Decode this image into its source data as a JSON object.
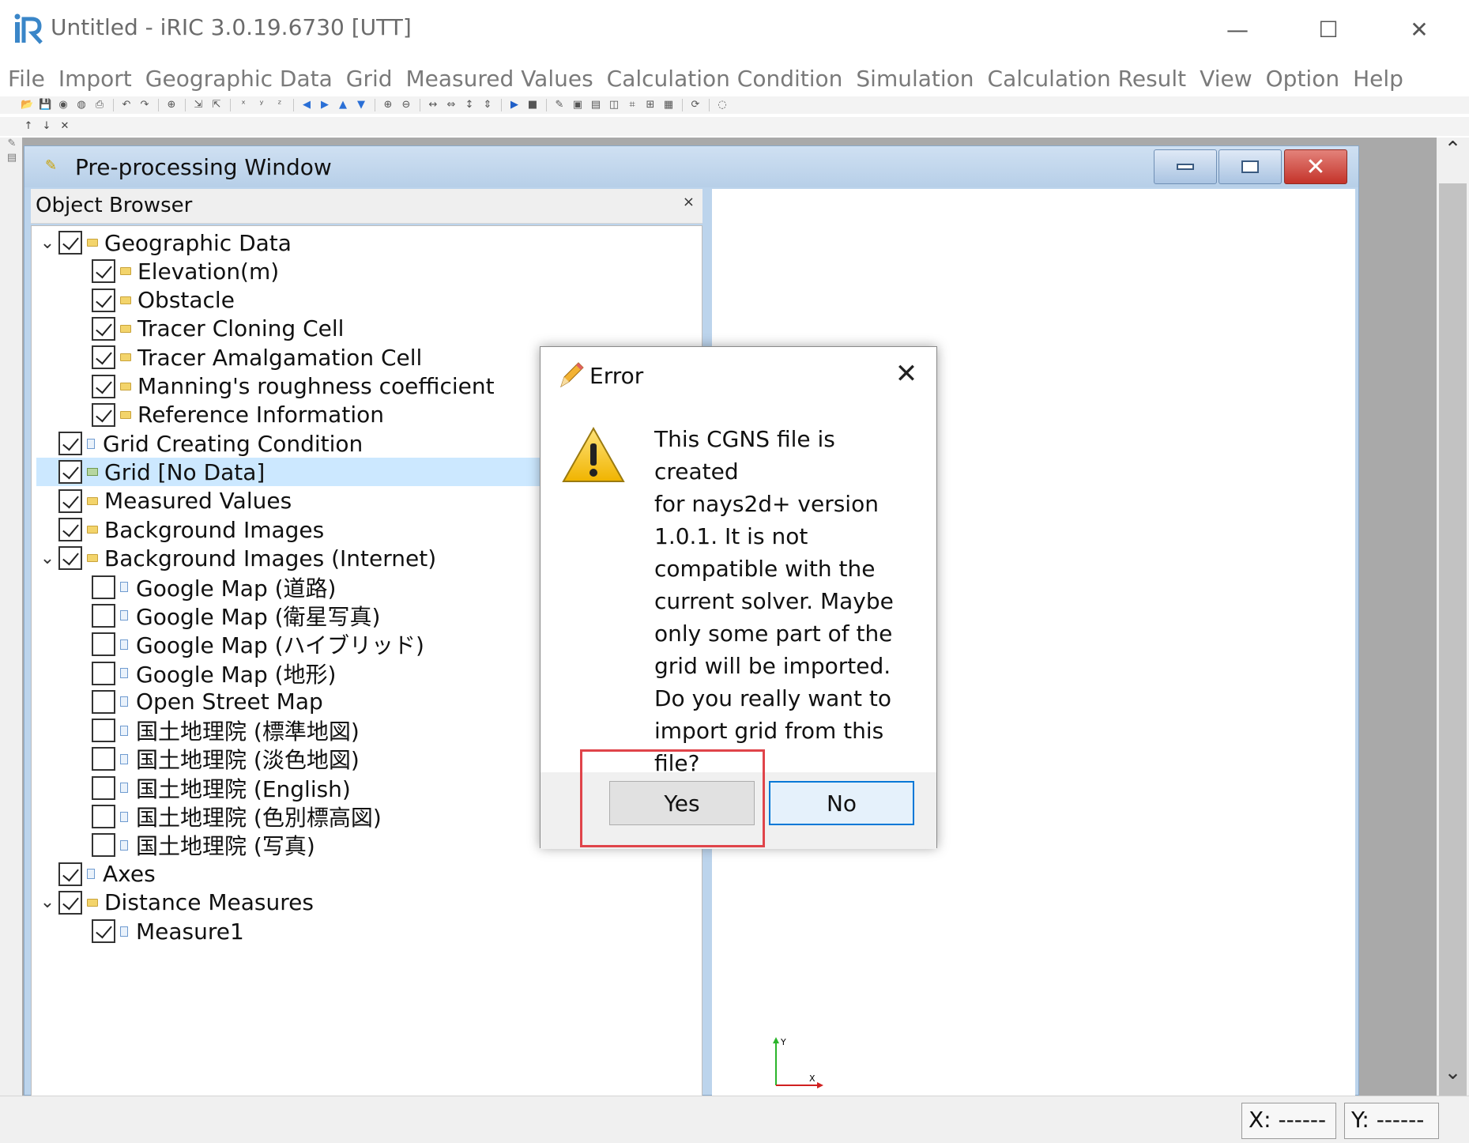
{
  "window": {
    "title": "Untitled - iRIC 3.0.19.6730 [UTT]",
    "controls": {
      "minimize": "—",
      "maximize": "☐",
      "close": "✕"
    }
  },
  "menu": [
    "File",
    "Import",
    "Geographic Data",
    "Grid",
    "Measured Values",
    "Calculation Condition",
    "Simulation",
    "Calculation Result",
    "View",
    "Option",
    "Help"
  ],
  "toolbar_icons": [
    "open-icon",
    "save-icon",
    "snapshot-icon",
    "snapshot-movie-icon",
    "print-icon",
    "undo-icon",
    "redo-icon",
    "zoom-fit-icon",
    "import-icon",
    "export-icon",
    "x-axis-icon",
    "y-axis-icon",
    "z-axis-icon",
    "move-left-icon",
    "move-right-icon",
    "move-up-icon",
    "move-down-icon",
    "zoom-in-icon",
    "zoom-out-icon",
    "pan-horizontal-icon",
    "pan-horizontal-alt-icon",
    "pan-vertical-icon",
    "pan-vertical-alt-icon",
    "run-icon",
    "stop-icon",
    "edit-icon",
    "view-2d-icon",
    "view-2d-alt-icon",
    "view-3d-icon",
    "graph-icon",
    "graph-alt-icon",
    "graph-table-icon",
    "refresh-icon",
    "mouse-icon"
  ],
  "toolbar2_icons": [
    "arrow-up-icon",
    "arrow-down-icon",
    "delete-icon"
  ],
  "pre_window": {
    "title": "Pre-processing Window",
    "object_browser": {
      "title": "Object Browser",
      "close": "×",
      "items": [
        {
          "label": "Geographic Data",
          "level": 0,
          "expander": "⌄",
          "checked": true,
          "icon": "folder-icon"
        },
        {
          "label": "Elevation(m)",
          "level": 1,
          "checked": true,
          "icon": "folder-icon"
        },
        {
          "label": "Obstacle",
          "level": 1,
          "checked": true,
          "icon": "folder-icon"
        },
        {
          "label": "Tracer Cloning Cell",
          "level": 1,
          "checked": true,
          "icon": "folder-icon"
        },
        {
          "label": "Tracer Amalgamation Cell",
          "level": 1,
          "checked": true,
          "icon": "folder-icon"
        },
        {
          "label": "Manning's roughness coefficient",
          "level": 1,
          "checked": true,
          "icon": "folder-icon"
        },
        {
          "label": "Reference Information",
          "level": 1,
          "checked": true,
          "icon": "folder-icon"
        },
        {
          "label": "Grid Creating Condition",
          "level": 0,
          "checked": true,
          "icon": "doc-icon"
        },
        {
          "label": "Grid [No Data]",
          "level": 0,
          "checked": true,
          "icon": "grid-icon",
          "selected": true
        },
        {
          "label": "Measured Values",
          "level": 0,
          "checked": true,
          "icon": "folder-icon"
        },
        {
          "label": "Background Images",
          "level": 0,
          "checked": true,
          "icon": "folder-icon"
        },
        {
          "label": "Background Images (Internet)",
          "level": 0,
          "expander": "⌄",
          "checked": true,
          "icon": "folder-icon"
        },
        {
          "label": "Google Map (道路)",
          "level": 1,
          "checked": false,
          "icon": "doc-icon"
        },
        {
          "label": "Google Map (衛星写真)",
          "level": 1,
          "checked": false,
          "icon": "doc-icon"
        },
        {
          "label": "Google Map (ハイブリッド)",
          "level": 1,
          "checked": false,
          "icon": "doc-icon"
        },
        {
          "label": "Google Map (地形)",
          "level": 1,
          "checked": false,
          "icon": "doc-icon"
        },
        {
          "label": "Open Street Map",
          "level": 1,
          "checked": false,
          "icon": "doc-icon"
        },
        {
          "label": "国土地理院 (標準地図)",
          "level": 1,
          "checked": false,
          "icon": "doc-icon"
        },
        {
          "label": "国土地理院 (淡色地図)",
          "level": 1,
          "checked": false,
          "icon": "doc-icon"
        },
        {
          "label": "国土地理院 (English)",
          "level": 1,
          "checked": false,
          "icon": "doc-icon"
        },
        {
          "label": "国土地理院 (色別標高図)",
          "level": 1,
          "checked": false,
          "icon": "doc-icon"
        },
        {
          "label": "国土地理院 (写真)",
          "level": 1,
          "checked": false,
          "icon": "doc-icon"
        },
        {
          "label": "Axes",
          "level": 0,
          "checked": true,
          "icon": "doc-icon"
        },
        {
          "label": "Distance Measures",
          "level": 0,
          "expander": "⌄",
          "checked": true,
          "icon": "folder-icon"
        },
        {
          "label": "Measure1",
          "level": 1,
          "checked": true,
          "icon": "doc-icon"
        }
      ]
    },
    "axes": {
      "x": "X",
      "y": "Y"
    }
  },
  "dialog": {
    "title": "Error",
    "close": "✕",
    "message": "This CGNS file is created\nfor nays2d+ version\n1.0.1. It is not\ncompatible with the\ncurrent solver. Maybe\nonly some part of the\ngrid will be imported.\nDo you really want to\nimport grid from this\nfile?",
    "yes_label": "Yes",
    "no_label": "No"
  },
  "statusbar": {
    "x": "X: ------",
    "y": "Y: ------"
  },
  "colors": {
    "selection": "#cce8ff",
    "highlight": "#e0444a",
    "default_button_border": "#0078d7",
    "mdi_title": "#bcd4ec"
  }
}
